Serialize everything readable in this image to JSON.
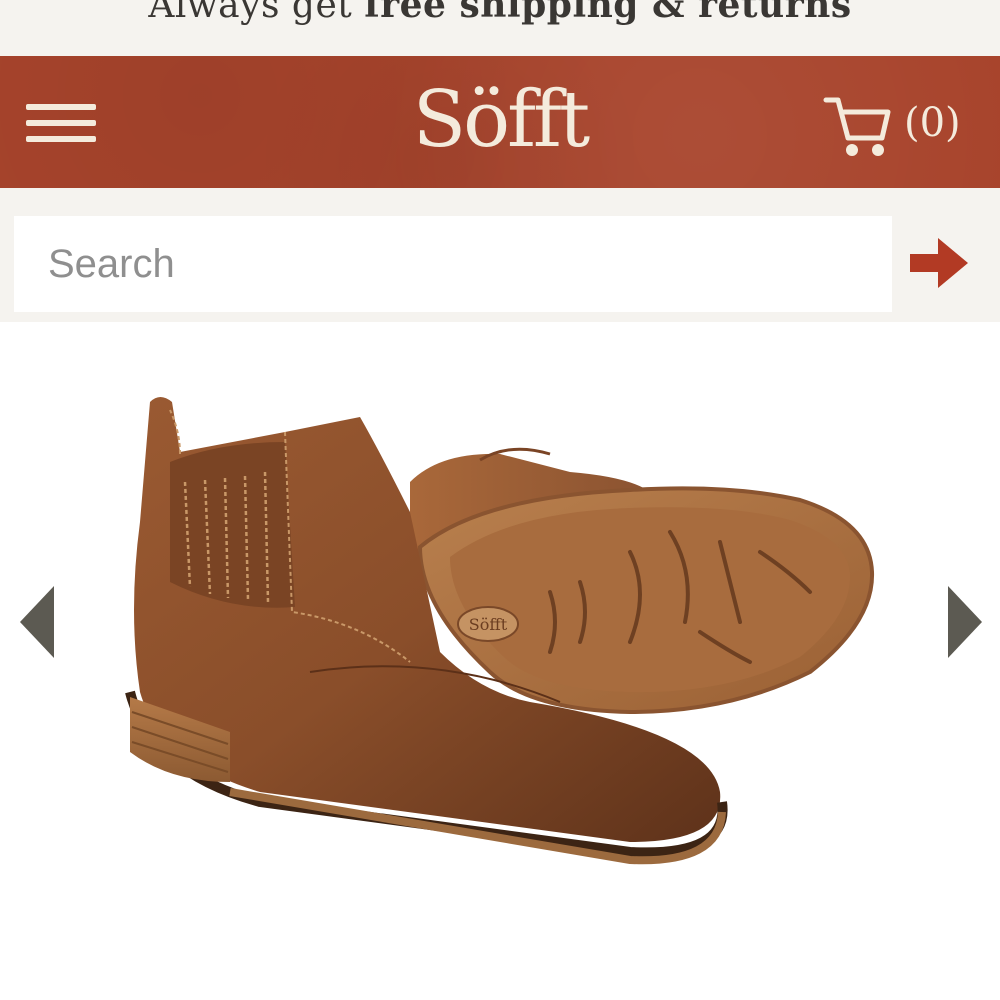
{
  "promo": {
    "prefix": "Always get",
    "bold": "free shipping & returns"
  },
  "header": {
    "logo": "Söfft",
    "cart_count": "(0)",
    "colors": {
      "band": "#a8442c",
      "ink": "#f4ebdc"
    }
  },
  "icons": {
    "menu": "hamburger-icon",
    "cart": "cart-icon",
    "search_go": "arrow-right-icon",
    "prev": "chevron-left-icon",
    "next": "chevron-right-icon"
  },
  "search": {
    "placeholder": "Search",
    "value": ""
  },
  "product": {
    "sole_logo": "Söfft"
  }
}
